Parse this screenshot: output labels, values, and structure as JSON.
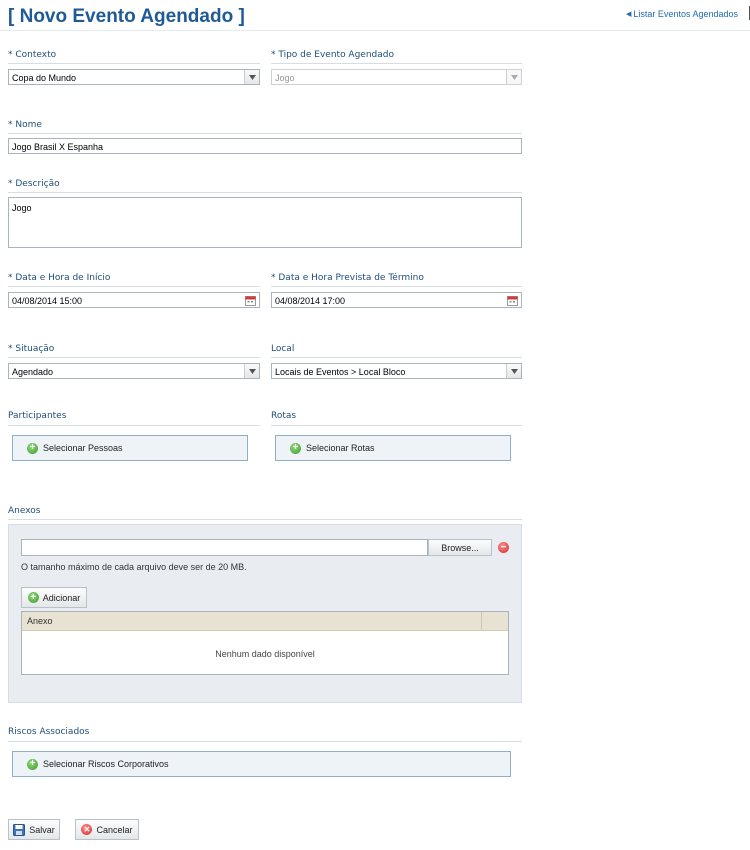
{
  "page": {
    "title": "[ Novo Evento Agendado ]",
    "list_link": "Listar Eventos Agendados"
  },
  "form": {
    "contexto": {
      "label": "Contexto",
      "value": "Copa do Mundo"
    },
    "tipo": {
      "label": "Tipo de Evento Agendado",
      "value": "Jogo"
    },
    "nome": {
      "label": "Nome",
      "value": "Jogo Brasil X Espanha"
    },
    "descricao": {
      "label": "Descrição",
      "value": "Jogo"
    },
    "inicio": {
      "label": "Data e Hora de Início",
      "value": "04/08/2014 15:00"
    },
    "termino": {
      "label": "Data e Hora Prevista de Término",
      "value": "04/08/2014 17:00"
    },
    "situacao": {
      "label": "Situação",
      "value": "Agendado"
    },
    "local": {
      "label": "Local",
      "value": "Locais de Eventos > Local Bloco"
    }
  },
  "required_mark": "*",
  "participantes": {
    "label": "Participantes",
    "button": "Selecionar Pessoas"
  },
  "rotas": {
    "label": "Rotas",
    "button": "Selecionar Rotas"
  },
  "anexos": {
    "label": "Anexos",
    "browse": "Browse...",
    "note": "O tamanho máximo de cada arquivo deve ser de 20 MB.",
    "add_button": "Adicionar",
    "column": "Anexo",
    "empty": "Nenhum dado disponível"
  },
  "riscos": {
    "label": "Riscos Associados",
    "button": "Selecionar Riscos Corporativos"
  },
  "actions": {
    "save": "Salvar",
    "cancel": "Cancelar"
  },
  "icons": {
    "add": "plus-circle-icon",
    "remove": "minus-circle-icon",
    "calendar": "calendar-icon",
    "save": "floppy-icon",
    "cancel": "x-circle-icon",
    "dropdown": "chevron-down-icon",
    "link": "triangle-left-icon"
  },
  "colors": {
    "title": "#1e5a96",
    "label": "#1e4e7a",
    "link": "#1e6bb5",
    "grid_header": "#e7e2d1",
    "panel": "#e9edf1"
  }
}
